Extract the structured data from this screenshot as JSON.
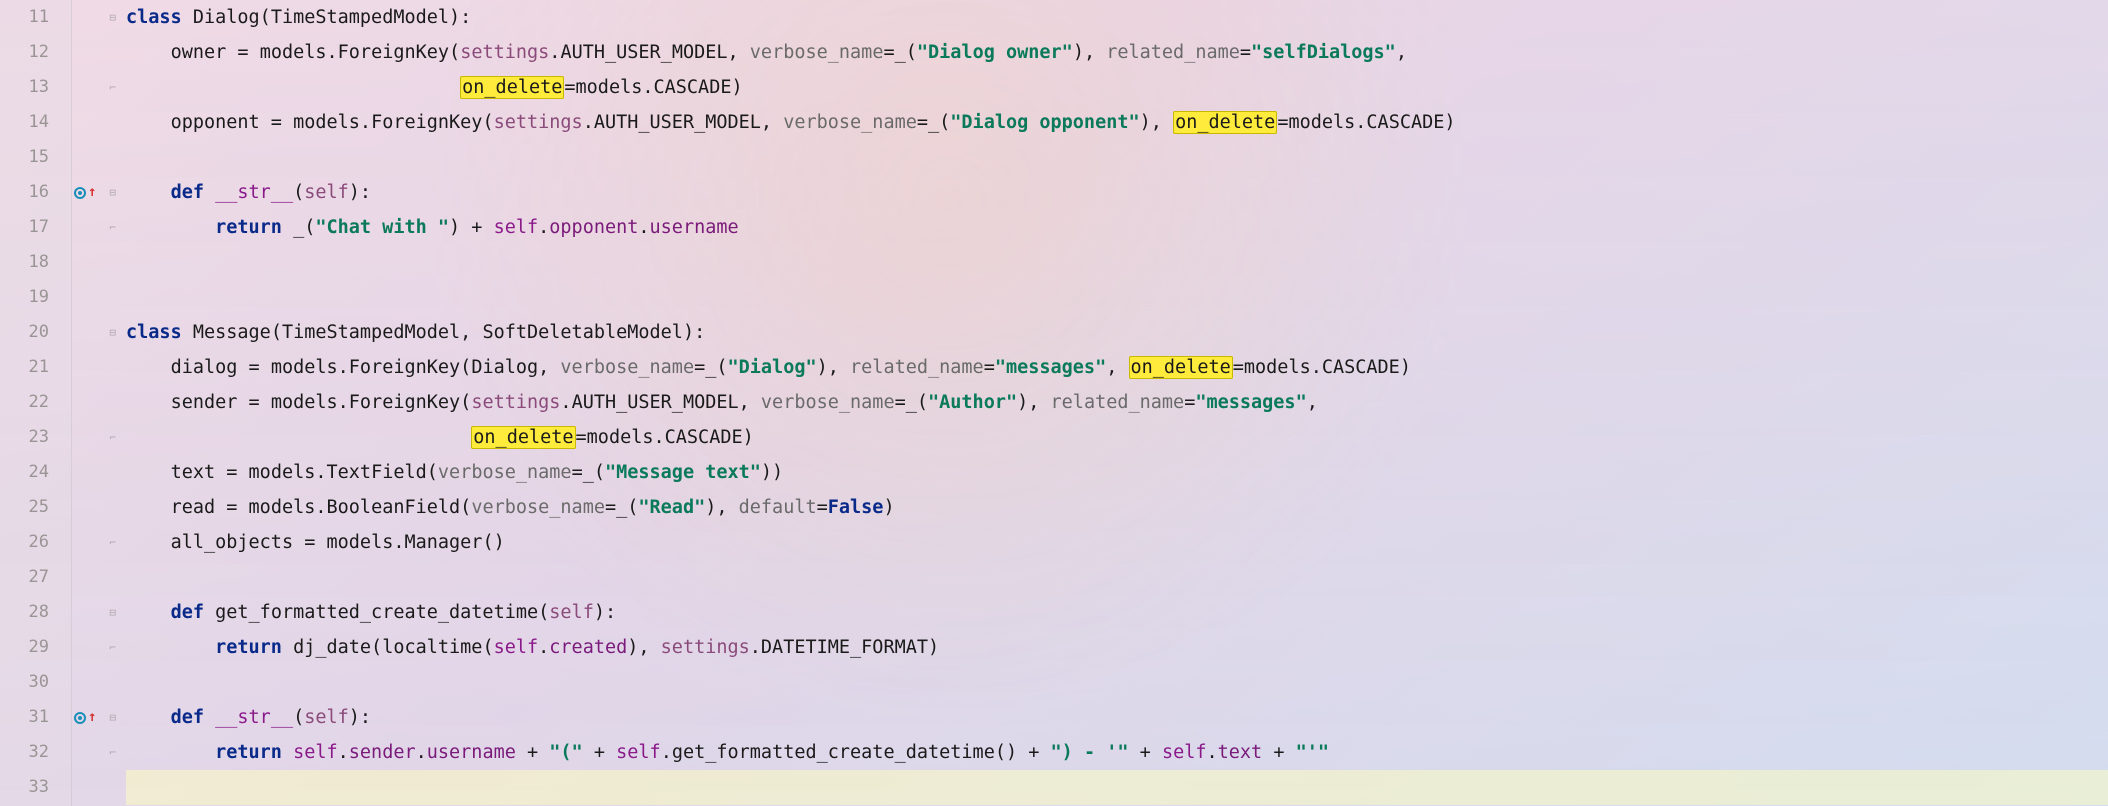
{
  "lines": {
    "start": 11,
    "end": 33
  },
  "override_markers": [
    16,
    31
  ],
  "fold_open": [
    11,
    16,
    20,
    28,
    31
  ],
  "fold_close": [
    13,
    17,
    23,
    26,
    29,
    32
  ],
  "code": {
    "l11": {
      "kw_class": "class",
      "name": "Dialog",
      "base": "TimeStampedModel"
    },
    "l12": {
      "field": "owner",
      "mod": "models",
      "fk": "ForeignKey",
      "settings": "settings",
      "auth": "AUTH_USER_MODEL",
      "vn": "verbose_name",
      "vn_val": "\"Dialog owner\"",
      "rn": "related_name",
      "rn_val": "\"selfDialogs\""
    },
    "l13": {
      "od": "on_delete",
      "mod": "models",
      "cascade": "CASCADE"
    },
    "l14": {
      "field": "opponent",
      "mod": "models",
      "fk": "ForeignKey",
      "settings": "settings",
      "auth": "AUTH_USER_MODEL",
      "vn": "verbose_name",
      "vn_val": "\"Dialog opponent\"",
      "od": "on_delete",
      "cascade": "CASCADE"
    },
    "l16": {
      "kw_def": "def",
      "name": "__str__",
      "self": "self"
    },
    "l17": {
      "kw_return": "return",
      "str": "\"Chat with \"",
      "self": "self",
      "opp": "opponent",
      "user": "username"
    },
    "l20": {
      "kw_class": "class",
      "name": "Message",
      "b1": "TimeStampedModel",
      "b2": "SoftDeletableModel"
    },
    "l21": {
      "field": "dialog",
      "mod": "models",
      "fk": "ForeignKey",
      "target": "Dialog",
      "vn": "verbose_name",
      "vn_val": "\"Dialog\"",
      "rn": "related_name",
      "rn_val": "\"messages\"",
      "od": "on_delete",
      "cascade": "CASCADE"
    },
    "l22": {
      "field": "sender",
      "mod": "models",
      "fk": "ForeignKey",
      "settings": "settings",
      "auth": "AUTH_USER_MODEL",
      "vn": "verbose_name",
      "vn_val": "\"Author\"",
      "rn": "related_name",
      "rn_val": "\"messages\""
    },
    "l23": {
      "od": "on_delete",
      "mod": "models",
      "cascade": "CASCADE"
    },
    "l24": {
      "field": "text",
      "mod": "models",
      "tf": "TextField",
      "vn": "verbose_name",
      "vn_val": "\"Message text\""
    },
    "l25": {
      "field": "read",
      "mod": "models",
      "bf": "BooleanField",
      "vn": "verbose_name",
      "vn_val": "\"Read\"",
      "def": "default",
      "false": "False"
    },
    "l26": {
      "field": "all_objects",
      "mod": "models",
      "mgr": "Manager"
    },
    "l28": {
      "kw_def": "def",
      "name": "get_formatted_create_datetime",
      "self": "self"
    },
    "l29": {
      "kw_return": "return",
      "dj": "dj_date",
      "lt": "localtime",
      "self": "self",
      "created": "created",
      "settings": "settings",
      "fmt": "DATETIME_FORMAT"
    },
    "l31": {
      "kw_def": "def",
      "name": "__str__",
      "self": "self"
    },
    "l32": {
      "kw_return": "return",
      "self": "self",
      "sender": "sender",
      "user": "username",
      "s1": "\"(\"",
      "fmt": "get_formatted_create_datetime",
      "s2": "\") - '\"",
      "text": "text",
      "s3": "\"'\""
    }
  }
}
